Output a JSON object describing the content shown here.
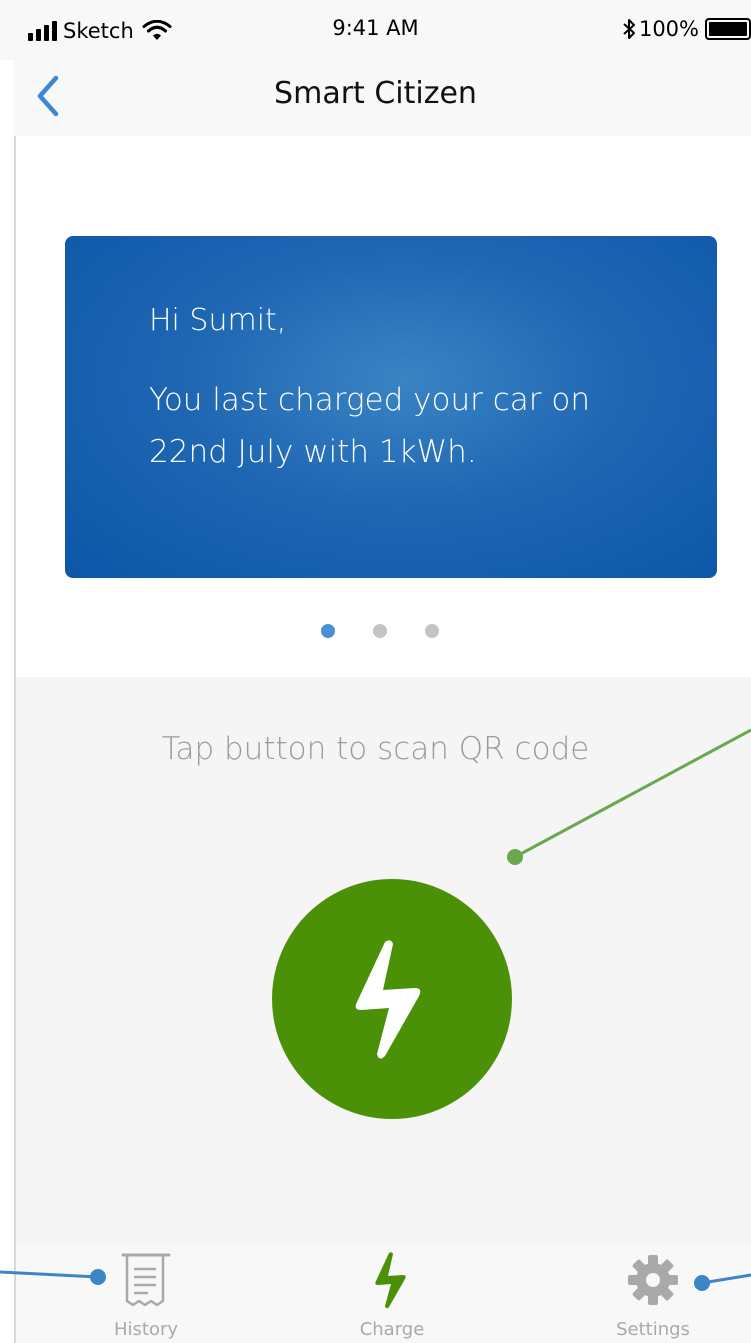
{
  "status_bar": {
    "carrier": "Sketch",
    "time": "9:41 AM",
    "battery": "100%"
  },
  "nav": {
    "title": "Smart Citizen",
    "back_icon": "chevron-left-icon"
  },
  "card": {
    "greeting": "Hi Sumit,",
    "message": "You last charged your car on 22nd July with 1kWh."
  },
  "carousel": {
    "pages": 3,
    "active_index": 0
  },
  "action": {
    "hint": "Tap button to scan QR code",
    "button_icon": "lightning-bolt-icon"
  },
  "tabs": [
    {
      "label": "History",
      "icon": "receipt-icon"
    },
    {
      "label": "Charge",
      "icon": "lightning-bolt-icon",
      "active": true
    },
    {
      "label": "Settings",
      "icon": "gear-icon"
    }
  ],
  "colors": {
    "accent_green": "#4b9107",
    "card_blue": "#1f67b3",
    "link_blue": "#4a90d9",
    "annotation_green": "#6aa84f",
    "annotation_blue": "#3d85c6"
  }
}
